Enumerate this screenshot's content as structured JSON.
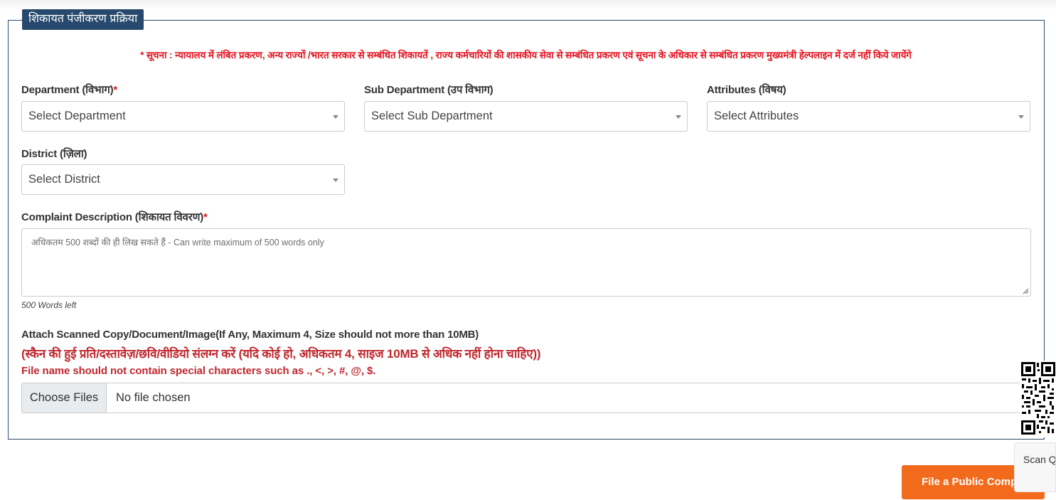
{
  "form": {
    "legend": "शिकायत पंजीकरण प्रक्रिया",
    "notice": "* सूचना : न्यायालय में लंबित प्रकरण, अन्य राज्यों /भारत सरकार से सम्बंधित शिकायतें , राज्य कर्मचारियों की शासकीय सेवा से सम्बंधित प्रकरण एवं सूचना के अधिकार से सम्बंधित प्रकरण मुख्यमंत्री हेल्पलाइन में दर्ज नहीं किये जायेंगे",
    "department": {
      "label": "Department (विभाग)",
      "required_mark": "*",
      "value": "Select Department"
    },
    "sub_department": {
      "label": "Sub Department (उप विभाग)",
      "value": "Select Sub Department"
    },
    "attributes": {
      "label": "Attributes (विषय)",
      "value": "Select Attributes"
    },
    "district": {
      "label": "District (ज़िला)",
      "value": "Select District"
    },
    "description": {
      "label": "Complaint Description (शिकायत विवरण)",
      "required_mark": "*",
      "placeholder": "अधिकतम 500 शब्दों की ही लिख सकते हैं - Can write maximum of 500 words only",
      "words_left": "500 Words left"
    },
    "attachment": {
      "label_en": "Attach Scanned Copy/Document/Image(If Any, Maximum 4, Size should not more than 10MB)",
      "label_hi": "(स्कैन की हुई प्रति/दस्तावेज़/छवि/वीडियो संलग्न करें (यदि कोई हो, अधिकतम 4, साइज 10MB से अधिक नहीं होना चाहिए))",
      "warning": "File name should not contain special characters such as ., <, >, #, @, $.",
      "button": "Choose Files",
      "status": "No file chosen"
    },
    "submit": "File a Public Complaint"
  },
  "qr_widget": {
    "caption": "Scan QR",
    "icon": "qr-code-icon"
  },
  "colors": {
    "legend_bg": "#27496d",
    "notice_red": "#e3121f",
    "attach_red": "#c0272d",
    "submit_orange": "#f26b1d"
  }
}
